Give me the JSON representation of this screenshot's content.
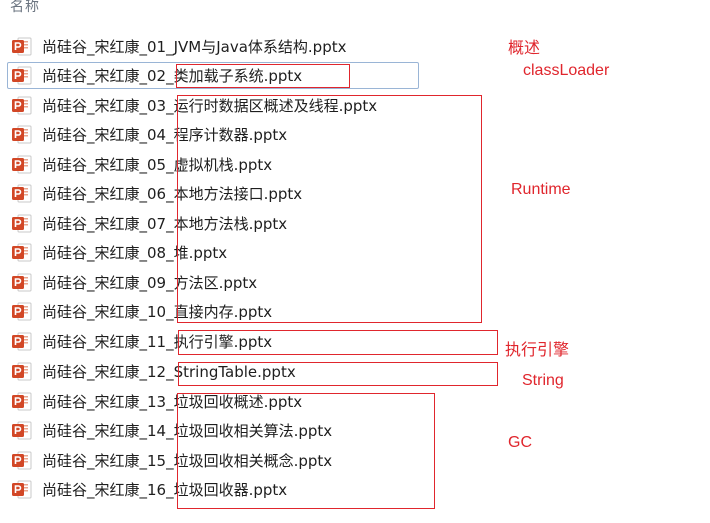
{
  "header": {
    "name_label": "名称"
  },
  "files": [
    "尚硅谷_宋红康_01_JVM与Java体系结构.pptx",
    "尚硅谷_宋红康_02_类加载子系统.pptx",
    "尚硅谷_宋红康_03_运行时数据区概述及线程.pptx",
    "尚硅谷_宋红康_04_程序计数器.pptx",
    "尚硅谷_宋红康_05_虚拟机栈.pptx",
    "尚硅谷_宋红康_06_本地方法接口.pptx",
    "尚硅谷_宋红康_07_本地方法栈.pptx",
    "尚硅谷_宋红康_08_堆.pptx",
    "尚硅谷_宋红康_09_方法区.pptx",
    "尚硅谷_宋红康_10_直接内存.pptx",
    "尚硅谷_宋红康_11_执行引擎.pptx",
    "尚硅谷_宋红康_12_StringTable.pptx",
    "尚硅谷_宋红康_13_垃圾回收概述.pptx",
    "尚硅谷_宋红康_14_垃圾回收相关算法.pptx",
    "尚硅谷_宋红康_15_垃圾回收相关概念.pptx",
    "尚硅谷_宋红康_16_垃圾回收器.pptx"
  ],
  "annotations": {
    "overview": "概述",
    "classloader": "classLoader",
    "runtime": "Runtime",
    "engine": "执行引擎",
    "string": "String",
    "gc": "GC"
  },
  "colors": {
    "annotation": "#e0262d",
    "pptx_icon": "#d24726",
    "selection_border": "#9ab5d6"
  },
  "icon_name": "powerpoint-file-icon"
}
